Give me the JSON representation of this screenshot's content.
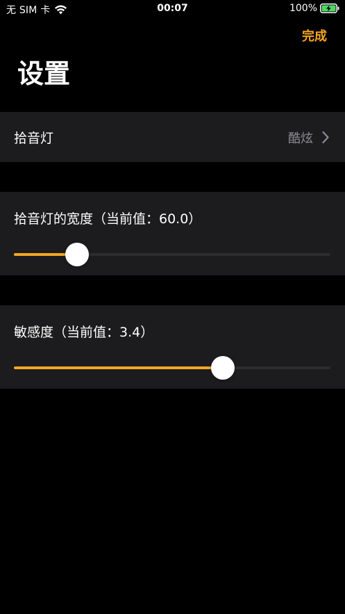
{
  "status_bar": {
    "carrier": "无 SIM 卡",
    "time": "00:07",
    "battery": "100%"
  },
  "nav": {
    "done_label": "完成"
  },
  "page": {
    "title": "设置"
  },
  "mode_cell": {
    "label": "拾音灯",
    "value": "酷炫"
  },
  "width_cell": {
    "label": "拾音灯的宽度（当前值：60.0）",
    "slider_fraction": 0.2
  },
  "sensitivity_cell": {
    "label": "敏感度（当前值：3.4）",
    "slider_fraction": 0.66
  },
  "colors": {
    "accent": "#f6a623",
    "background": "#000000",
    "cell_background": "#1c1c1e",
    "track": "#2c2c2e",
    "secondary_text": "#8e8e93",
    "battery_charge": "#4cd964"
  },
  "icons": {
    "wifi": "wifi-icon",
    "battery": "battery-charging-icon",
    "chevron": "chevron-right-icon"
  }
}
